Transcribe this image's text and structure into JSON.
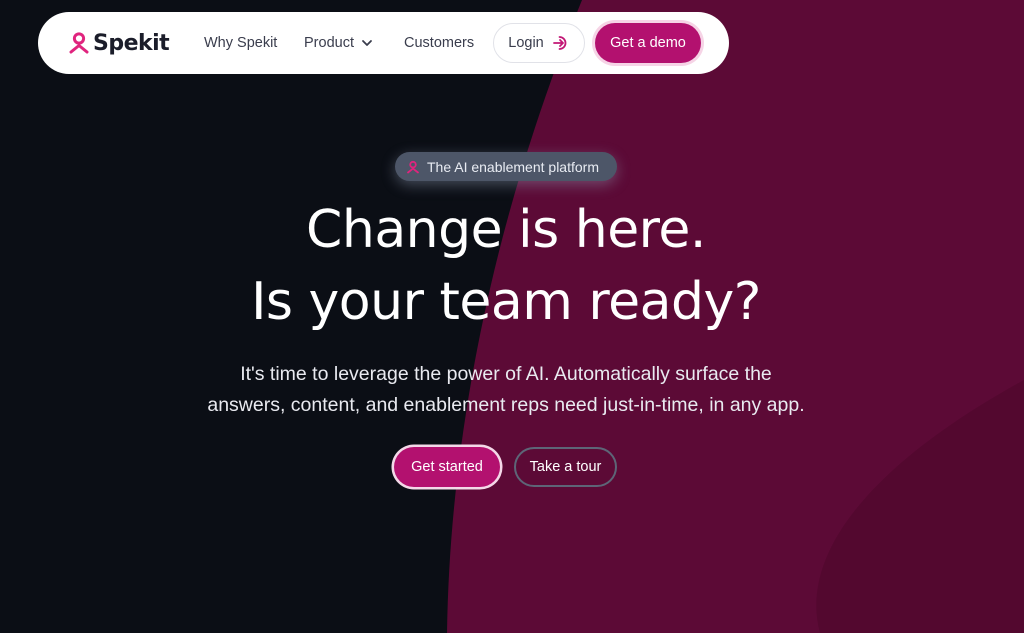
{
  "nav": {
    "logo_text": "Spekit",
    "links": [
      {
        "label": "Why Spekit"
      },
      {
        "label": "Product"
      },
      {
        "label": "Customers"
      }
    ],
    "login_label": "Login",
    "demo_label": "Get a demo"
  },
  "hero": {
    "badge": "The AI enablement platform",
    "headline_line1": "Change is here.",
    "headline_line2": "Is your team ready?",
    "subtext_line1": "It's time to leverage the power of AI. Automatically surface the",
    "subtext_line2": "answers, content, and enablement reps need just-in-time, in any app.",
    "cta_primary": "Get started",
    "cta_secondary": "Take a tour"
  },
  "colors": {
    "background": "#0b0e15",
    "accent": "#b3116f",
    "brand_pink": "#e0247e",
    "magenta_panel": "#5c0a36"
  },
  "icons": {
    "logo": "spekit-logo-icon",
    "product_dropdown": "chevron-down-icon",
    "login": "login-arrow-icon",
    "badge": "spekit-badge-icon"
  }
}
